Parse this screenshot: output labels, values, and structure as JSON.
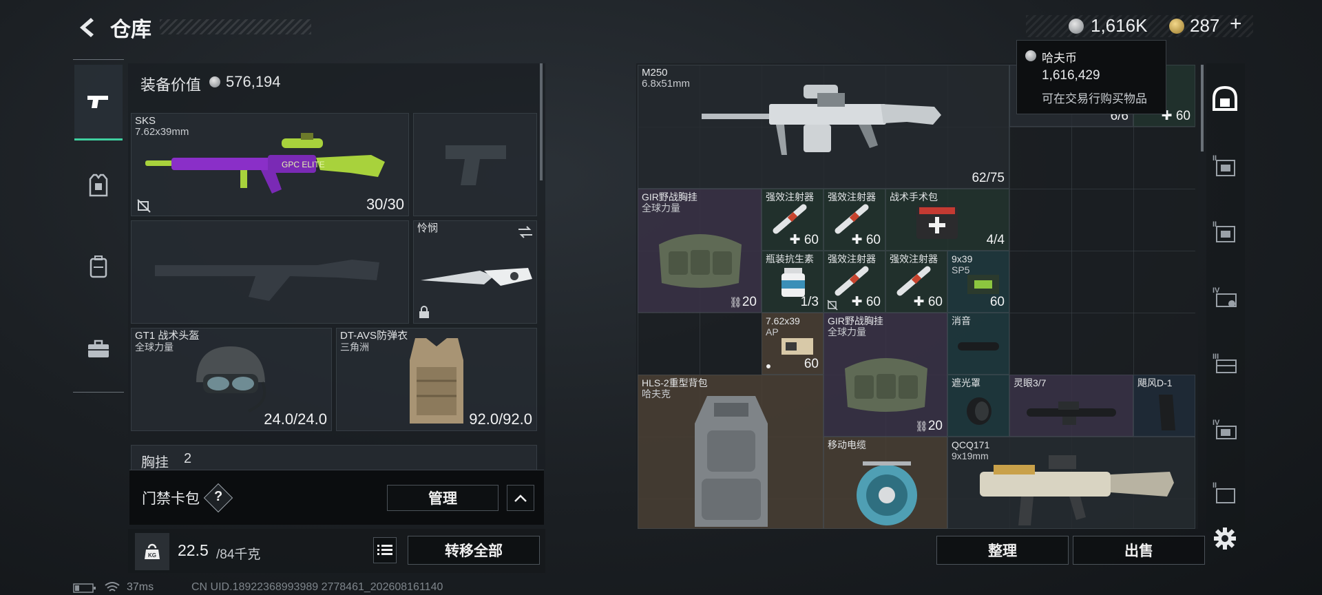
{
  "header": {
    "title": "仓库"
  },
  "currency": {
    "haf_coins": "1,616K",
    "premium": "287",
    "premium_plus": "+",
    "tooltip": {
      "name": "哈夫币",
      "amount": "1,616,429",
      "desc": "可在交易行购买物品"
    }
  },
  "loadout": {
    "value_label": "装备价值",
    "value": "576,194",
    "primary": {
      "name": "SKS",
      "caliber": "7.62x39mm",
      "ammo": "30/30"
    },
    "melee": {
      "name": "怜悯"
    },
    "helmet": {
      "name": "GT1 战术头盔",
      "brand": "全球力量",
      "durability": "24.0/24.0"
    },
    "armor": {
      "name": "DT-AVS防弹衣",
      "brand": "三角洲",
      "durability": "92.0/92.0"
    },
    "chest_label": "胸挂",
    "chest_count": "2",
    "keycard_label": "门禁卡包",
    "keycard_help": "?",
    "manage_label": "管理",
    "weight": "22.5",
    "weight_unit": "/84千克",
    "transfer_label": "转移全部"
  },
  "stash": {
    "items": [
      {
        "name": "M250",
        "sub": "6.8x51mm",
        "count": "62/75"
      },
      {
        "name": "GIR野战胸挂",
        "sub": "全球力量",
        "count": "20"
      },
      {
        "name": "强效注射器",
        "count": "60"
      },
      {
        "name": "强效注射器",
        "count": "60"
      },
      {
        "name": "战术手术包",
        "count": "4/4"
      },
      {
        "name": "瓶装抗生素",
        "count": "1/3"
      },
      {
        "name": "强效注射器",
        "count": "60"
      },
      {
        "name": "强效注射器",
        "count": "60"
      },
      {
        "name": "9x39",
        "sub": "SP5",
        "count": "60"
      },
      {
        "name": "7.62x39",
        "sub": "AP",
        "count": "60"
      },
      {
        "name": "GIR野战胸挂",
        "sub": "全球力量",
        "count": "20"
      },
      {
        "name": "消音"
      },
      {
        "name": "HLS-2重型背包",
        "sub": "哈夫克"
      },
      {
        "name": "遮光罩"
      },
      {
        "name": "灵眼3/7"
      },
      {
        "name": "飓风D-1"
      },
      {
        "name": "移动电缆"
      },
      {
        "name": "QCQ171",
        "sub": "9x19mm"
      },
      {
        "name": "强效注射器",
        "count": "60"
      },
      {
        "count": "6/6"
      }
    ],
    "sort_label": "整理",
    "sell_label": "出售"
  },
  "status": {
    "ping": "37ms",
    "uid": "CN UID.18922368993989 2778461_202608161140"
  },
  "colors": {
    "accent_green": "#3fd0a0",
    "gold": "#c8a24a",
    "purple": "#3a3346",
    "teal": "#1f3a3e",
    "brown": "#4a3f34"
  }
}
